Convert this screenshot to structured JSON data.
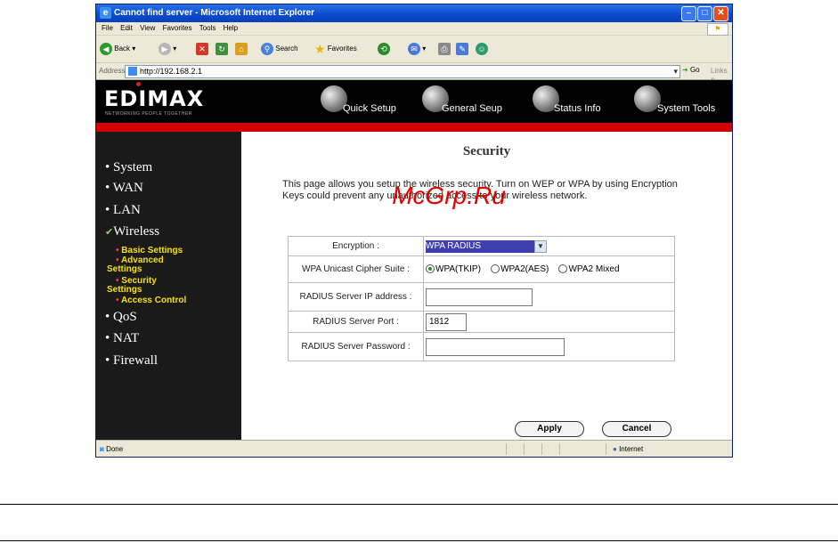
{
  "window": {
    "title": "Cannot find server - Microsoft Internet Explorer",
    "minimize_icon": "minimize-icon",
    "maximize_icon": "maximize-icon",
    "close_icon": "close-icon"
  },
  "menubar": {
    "items": [
      "File",
      "Edit",
      "View",
      "Favorites",
      "Tools",
      "Help"
    ]
  },
  "toolbar": {
    "back_label": "Back",
    "search_label": "Search",
    "favorites_label": "Favorites"
  },
  "address": {
    "label": "Address",
    "url": "http://192.168.2.1",
    "go_label": "Go",
    "links_label": "Links"
  },
  "router": {
    "brand": "EDIMAX",
    "tagline": "NETWORKING PEOPLE TOGETHER",
    "nav": [
      "Quick Setup",
      "General Setup",
      "Status Info",
      "System Tools"
    ],
    "nav_display": [
      "Quick Setup",
      "General Seup",
      "Status Info",
      "System Tools"
    ],
    "sidebar": {
      "system": "System",
      "wan": "WAN",
      "lan": "LAN",
      "wireless": "Wireless",
      "basic_settings": "Basic Settings",
      "advanced_1": "Advanced",
      "advanced_2": "Settings",
      "security_1": "Security",
      "security_2": "Settings",
      "access_control": "Access Control",
      "qos": "QoS",
      "nat": "NAT",
      "firewall": "Firewall"
    }
  },
  "page": {
    "title": "Security",
    "description": "This page allows you setup the wireless security. Turn on WEP or WPA by using Encryption Keys could prevent any unauthorized access to your wireless network.",
    "encryption_label": "Encryption :",
    "encryption_value": "WPA RADIUS",
    "cipher_label": "WPA Unicast Cipher Suite :",
    "cipher_options": [
      "WPA(TKIP)",
      "WPA2(AES)",
      "WPA2 Mixed"
    ],
    "cipher_selected": "WPA(TKIP)",
    "radius_ip_label": "RADIUS Server IP address :",
    "radius_ip_value": "",
    "radius_port_label": "RADIUS Server Port :",
    "radius_port_value": "1812",
    "radius_password_label": "RADIUS Server Password :",
    "radius_password_value": "",
    "apply_label": "Apply",
    "cancel_label": "Cancel"
  },
  "watermark": "McGrp.Ru",
  "status": {
    "text": "Done",
    "zone": "Internet"
  },
  "colors": {
    "title_bar": "#0a4cd0",
    "red_bar": "#d40000",
    "sidebar_bg": "#1a1a1a",
    "sub_link": "#f7e015",
    "watermark": "#e00000"
  }
}
